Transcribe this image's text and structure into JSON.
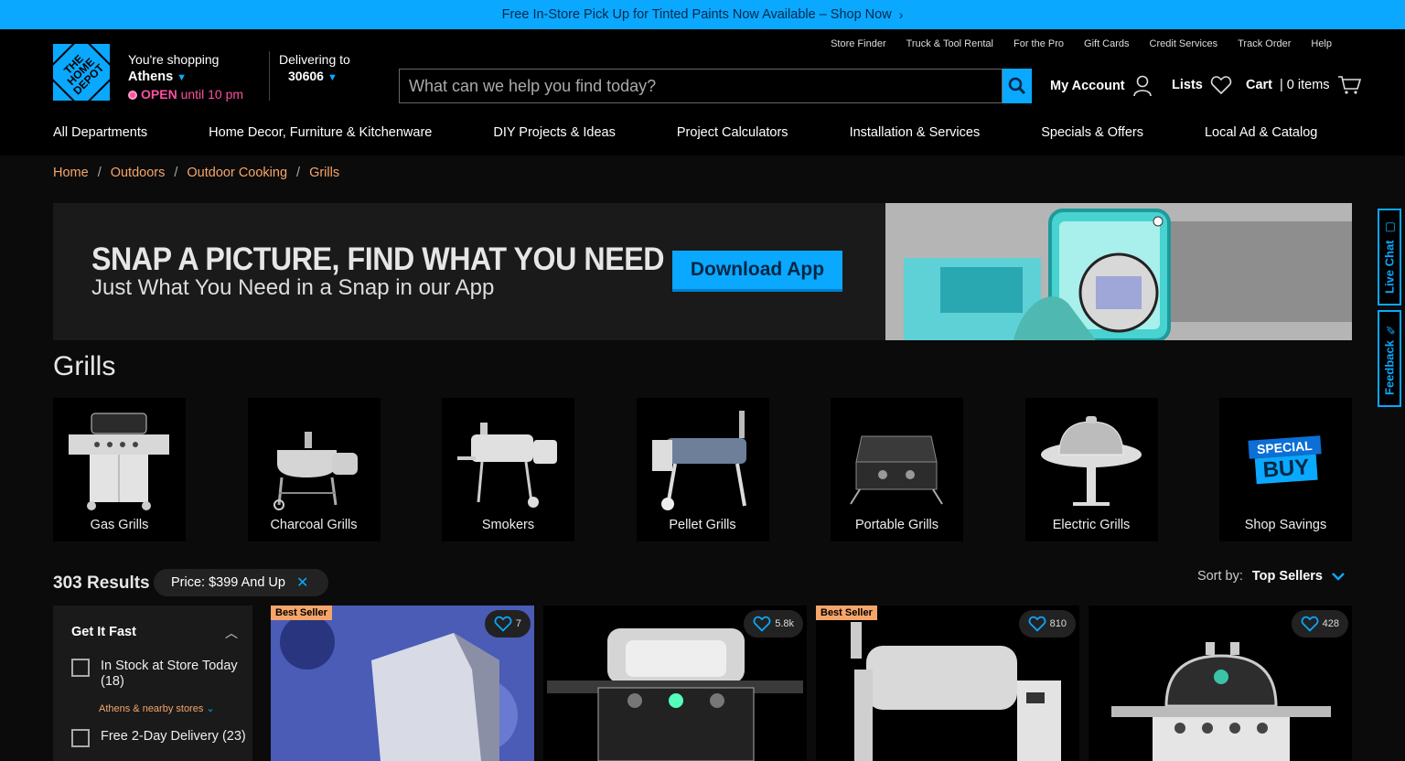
{
  "promo": {
    "text": "Free In-Store Pick Up for Tinted Paints Now Available – Shop Now"
  },
  "logo": {
    "text": "THE HOME DEPOT"
  },
  "store": {
    "label": "You're shopping",
    "name": "Athens",
    "status": "OPEN",
    "hours": "until 10 pm"
  },
  "delivery": {
    "label": "Delivering to",
    "zip": "30606"
  },
  "toplinks": [
    "Store Finder",
    "Truck & Tool Rental",
    "For the Pro",
    "Gift Cards",
    "Credit Services",
    "Track Order",
    "Help"
  ],
  "search": {
    "placeholder": "What can we help you find today?"
  },
  "account": {
    "my_account": "My Account",
    "lists": "Lists",
    "cart": "Cart",
    "cart_count": "| 0 items"
  },
  "nav": [
    "All Departments",
    "Home Decor, Furniture & Kitchenware",
    "DIY Projects & Ideas",
    "Project Calculators",
    "Installation & Services",
    "Specials & Offers",
    "Local Ad & Catalog"
  ],
  "breadcrumbs": [
    "Home",
    "Outdoors",
    "Outdoor Cooking",
    "Grills"
  ],
  "banner": {
    "headline": "SNAP A PICTURE, FIND WHAT YOU NEED",
    "subhead": "Just What You Need in a Snap in our App",
    "button": "Download App"
  },
  "page_title": "Grills",
  "categories": [
    {
      "label": "Gas Grills",
      "icon": "gas-grill-icon"
    },
    {
      "label": "Charcoal Grills",
      "icon": "charcoal-grill-icon"
    },
    {
      "label": "Smokers",
      "icon": "smoker-icon"
    },
    {
      "label": "Pellet Grills",
      "icon": "pellet-grill-icon"
    },
    {
      "label": "Portable Grills",
      "icon": "portable-grill-icon"
    },
    {
      "label": "Electric Grills",
      "icon": "electric-grill-icon"
    },
    {
      "label": "Shop Savings",
      "icon": "special-buy-icon",
      "badge_top": "SPECIAL",
      "badge_bottom": "BUY"
    }
  ],
  "results": {
    "count": "303 Results",
    "chip": "Price: $399 And Up",
    "sort_label": "Sort by:",
    "sort_value": "Top Sellers"
  },
  "filter": {
    "title": "Get It Fast",
    "options": [
      {
        "label": "In Stock at Store Today",
        "count": "(18)"
      },
      {
        "label": "Free 2-Day Delivery (23)"
      }
    ],
    "nearby": "Athens & nearby stores"
  },
  "products": [
    {
      "badge": "Best Seller",
      "favorites": "7"
    },
    {
      "badge": "",
      "favorites": "5.8k"
    },
    {
      "badge": "Best Seller",
      "favorites": "810"
    },
    {
      "badge": "",
      "favorites": "428"
    }
  ],
  "side_tabs": {
    "chat": "Live Chat",
    "feedback": "Feedback"
  },
  "colors": {
    "accent": "#0aa8ff",
    "link": "#f6a56a",
    "background": "#0b0b0b",
    "open": "#ff4fa0"
  }
}
